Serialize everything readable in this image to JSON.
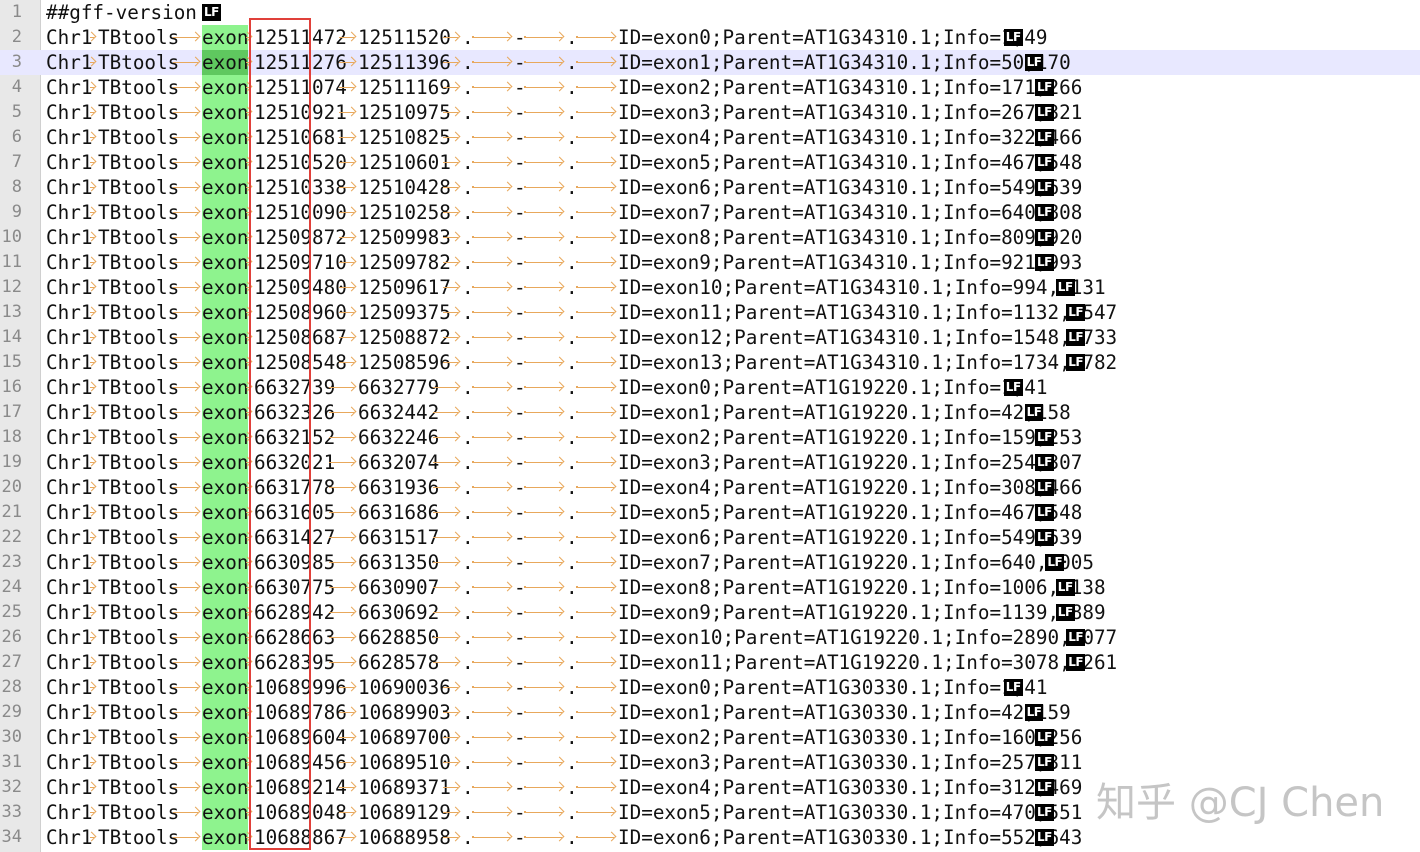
{
  "editor": {
    "current_line": 3,
    "header": "##gff-version 3",
    "rows": [
      {
        "seqid": "Chr1",
        "source": "TBtools",
        "type": "exon",
        "start": "12511472",
        "end": "12511520",
        "score": ".",
        "strand": "-",
        "phase": ".",
        "attributes": "ID=exon0;Parent=AT1G34310.1;Info=1,49"
      },
      {
        "seqid": "Chr1",
        "source": "TBtools",
        "type": "exon",
        "start": "12511276",
        "end": "12511396",
        "score": ".",
        "strand": "-",
        "phase": ".",
        "attributes": "ID=exon1;Parent=AT1G34310.1;Info=50,170"
      },
      {
        "seqid": "Chr1",
        "source": "TBtools",
        "type": "exon",
        "start": "12511074",
        "end": "12511169",
        "score": ".",
        "strand": "-",
        "phase": ".",
        "attributes": "ID=exon2;Parent=AT1G34310.1;Info=171,266"
      },
      {
        "seqid": "Chr1",
        "source": "TBtools",
        "type": "exon",
        "start": "12510921",
        "end": "12510975",
        "score": ".",
        "strand": "-",
        "phase": ".",
        "attributes": "ID=exon3;Parent=AT1G34310.1;Info=267,321"
      },
      {
        "seqid": "Chr1",
        "source": "TBtools",
        "type": "exon",
        "start": "12510681",
        "end": "12510825",
        "score": ".",
        "strand": "-",
        "phase": ".",
        "attributes": "ID=exon4;Parent=AT1G34310.1;Info=322,466"
      },
      {
        "seqid": "Chr1",
        "source": "TBtools",
        "type": "exon",
        "start": "12510520",
        "end": "12510601",
        "score": ".",
        "strand": "-",
        "phase": ".",
        "attributes": "ID=exon5;Parent=AT1G34310.1;Info=467,548"
      },
      {
        "seqid": "Chr1",
        "source": "TBtools",
        "type": "exon",
        "start": "12510338",
        "end": "12510428",
        "score": ".",
        "strand": "-",
        "phase": ".",
        "attributes": "ID=exon6;Parent=AT1G34310.1;Info=549,639"
      },
      {
        "seqid": "Chr1",
        "source": "TBtools",
        "type": "exon",
        "start": "12510090",
        "end": "12510258",
        "score": ".",
        "strand": "-",
        "phase": ".",
        "attributes": "ID=exon7;Parent=AT1G34310.1;Info=640,808"
      },
      {
        "seqid": "Chr1",
        "source": "TBtools",
        "type": "exon",
        "start": "12509872",
        "end": "12509983",
        "score": ".",
        "strand": "-",
        "phase": ".",
        "attributes": "ID=exon8;Parent=AT1G34310.1;Info=809,920"
      },
      {
        "seqid": "Chr1",
        "source": "TBtools",
        "type": "exon",
        "start": "12509710",
        "end": "12509782",
        "score": ".",
        "strand": "-",
        "phase": ".",
        "attributes": "ID=exon9;Parent=AT1G34310.1;Info=921,993"
      },
      {
        "seqid": "Chr1",
        "source": "TBtools",
        "type": "exon",
        "start": "12509480",
        "end": "12509617",
        "score": ".",
        "strand": "-",
        "phase": ".",
        "attributes": "ID=exon10;Parent=AT1G34310.1;Info=994,1131"
      },
      {
        "seqid": "Chr1",
        "source": "TBtools",
        "type": "exon",
        "start": "12508960",
        "end": "12509375",
        "score": ".",
        "strand": "-",
        "phase": ".",
        "attributes": "ID=exon11;Parent=AT1G34310.1;Info=1132,1547"
      },
      {
        "seqid": "Chr1",
        "source": "TBtools",
        "type": "exon",
        "start": "12508687",
        "end": "12508872",
        "score": ".",
        "strand": "-",
        "phase": ".",
        "attributes": "ID=exon12;Parent=AT1G34310.1;Info=1548,1733"
      },
      {
        "seqid": "Chr1",
        "source": "TBtools",
        "type": "exon",
        "start": "12508548",
        "end": "12508596",
        "score": ".",
        "strand": "-",
        "phase": ".",
        "attributes": "ID=exon13;Parent=AT1G34310.1;Info=1734,1782"
      },
      {
        "seqid": "Chr1",
        "source": "TBtools",
        "type": "exon",
        "start": "6632739",
        "end": "6632779",
        "score": ".",
        "strand": "-",
        "phase": ".",
        "attributes": "ID=exon0;Parent=AT1G19220.1;Info=1,41"
      },
      {
        "seqid": "Chr1",
        "source": "TBtools",
        "type": "exon",
        "start": "6632326",
        "end": "6632442",
        "score": ".",
        "strand": "-",
        "phase": ".",
        "attributes": "ID=exon1;Parent=AT1G19220.1;Info=42,158"
      },
      {
        "seqid": "Chr1",
        "source": "TBtools",
        "type": "exon",
        "start": "6632152",
        "end": "6632246",
        "score": ".",
        "strand": "-",
        "phase": ".",
        "attributes": "ID=exon2;Parent=AT1G19220.1;Info=159,253"
      },
      {
        "seqid": "Chr1",
        "source": "TBtools",
        "type": "exon",
        "start": "6632021",
        "end": "6632074",
        "score": ".",
        "strand": "-",
        "phase": ".",
        "attributes": "ID=exon3;Parent=AT1G19220.1;Info=254,307"
      },
      {
        "seqid": "Chr1",
        "source": "TBtools",
        "type": "exon",
        "start": "6631778",
        "end": "6631936",
        "score": ".",
        "strand": "-",
        "phase": ".",
        "attributes": "ID=exon4;Parent=AT1G19220.1;Info=308,466"
      },
      {
        "seqid": "Chr1",
        "source": "TBtools",
        "type": "exon",
        "start": "6631605",
        "end": "6631686",
        "score": ".",
        "strand": "-",
        "phase": ".",
        "attributes": "ID=exon5;Parent=AT1G19220.1;Info=467,548"
      },
      {
        "seqid": "Chr1",
        "source": "TBtools",
        "type": "exon",
        "start": "6631427",
        "end": "6631517",
        "score": ".",
        "strand": "-",
        "phase": ".",
        "attributes": "ID=exon6;Parent=AT1G19220.1;Info=549,639"
      },
      {
        "seqid": "Chr1",
        "source": "TBtools",
        "type": "exon",
        "start": "6630985",
        "end": "6631350",
        "score": ".",
        "strand": "-",
        "phase": ".",
        "attributes": "ID=exon7;Parent=AT1G19220.1;Info=640,1005"
      },
      {
        "seqid": "Chr1",
        "source": "TBtools",
        "type": "exon",
        "start": "6630775",
        "end": "6630907",
        "score": ".",
        "strand": "-",
        "phase": ".",
        "attributes": "ID=exon8;Parent=AT1G19220.1;Info=1006,1138"
      },
      {
        "seqid": "Chr1",
        "source": "TBtools",
        "type": "exon",
        "start": "6628942",
        "end": "6630692",
        "score": ".",
        "strand": "-",
        "phase": ".",
        "attributes": "ID=exon9;Parent=AT1G19220.1;Info=1139,2889"
      },
      {
        "seqid": "Chr1",
        "source": "TBtools",
        "type": "exon",
        "start": "6628663",
        "end": "6628850",
        "score": ".",
        "strand": "-",
        "phase": ".",
        "attributes": "ID=exon10;Parent=AT1G19220.1;Info=2890,3077"
      },
      {
        "seqid": "Chr1",
        "source": "TBtools",
        "type": "exon",
        "start": "6628395",
        "end": "6628578",
        "score": ".",
        "strand": "-",
        "phase": ".",
        "attributes": "ID=exon11;Parent=AT1G19220.1;Info=3078,3261"
      },
      {
        "seqid": "Chr1",
        "source": "TBtools",
        "type": "exon",
        "start": "10689996",
        "end": "10690036",
        "score": ".",
        "strand": "-",
        "phase": ".",
        "attributes": "ID=exon0;Parent=AT1G30330.1;Info=1,41"
      },
      {
        "seqid": "Chr1",
        "source": "TBtools",
        "type": "exon",
        "start": "10689786",
        "end": "10689903",
        "score": ".",
        "strand": "-",
        "phase": ".",
        "attributes": "ID=exon1;Parent=AT1G30330.1;Info=42,159"
      },
      {
        "seqid": "Chr1",
        "source": "TBtools",
        "type": "exon",
        "start": "10689604",
        "end": "10689700",
        "score": ".",
        "strand": "-",
        "phase": ".",
        "attributes": "ID=exon2;Parent=AT1G30330.1;Info=160,256"
      },
      {
        "seqid": "Chr1",
        "source": "TBtools",
        "type": "exon",
        "start": "10689456",
        "end": "10689510",
        "score": ".",
        "strand": "-",
        "phase": ".",
        "attributes": "ID=exon3;Parent=AT1G30330.1;Info=257,311"
      },
      {
        "seqid": "Chr1",
        "source": "TBtools",
        "type": "exon",
        "start": "10689214",
        "end": "10689371",
        "score": ".",
        "strand": "-",
        "phase": ".",
        "attributes": "ID=exon4;Parent=AT1G30330.1;Info=312,469"
      },
      {
        "seqid": "Chr1",
        "source": "TBtools",
        "type": "exon",
        "start": "10689048",
        "end": "10689129",
        "score": ".",
        "strand": "-",
        "phase": ".",
        "attributes": "ID=exon5;Parent=AT1G30330.1;Info=470,551"
      },
      {
        "seqid": "Chr1",
        "source": "TBtools",
        "type": "exon",
        "start": "10688867",
        "end": "10688958",
        "score": ".",
        "strand": "-",
        "phase": ".",
        "attributes": "ID=exon6;Parent=AT1G30330.1;Info=552,643"
      }
    ],
    "eol_marker": "LF",
    "highlight_color": "#8ef38e",
    "selection_box_color": "#e0403a",
    "tab_arrow_color": "#e8a85c"
  },
  "watermark": "知乎 @CJ Chen"
}
